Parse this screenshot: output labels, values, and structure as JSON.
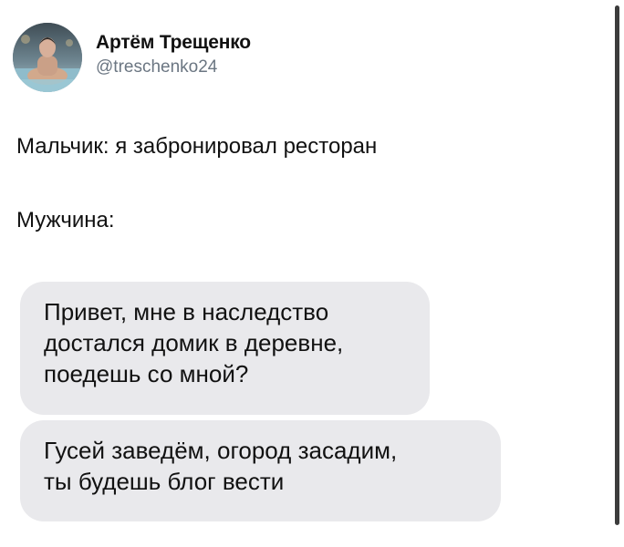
{
  "author": {
    "name": "Артём Трещенко",
    "handle": "@treschenko24"
  },
  "tweet": {
    "lines": [
      "Мальчик: я забронировал ресторан",
      "Мужчина:"
    ]
  },
  "messages": [
    {
      "lines": [
        "Привет, мне в наследство",
        "достался домик в деревне,",
        "поедешь со мной?"
      ]
    },
    {
      "lines": [
        "Гусей заведём, огород засадим,",
        "ты будешь блог вести"
      ]
    }
  ],
  "colors": {
    "bubble": "#e9e9ec",
    "handle": "#6b7682",
    "scrollbar": "#3c3c3c"
  }
}
